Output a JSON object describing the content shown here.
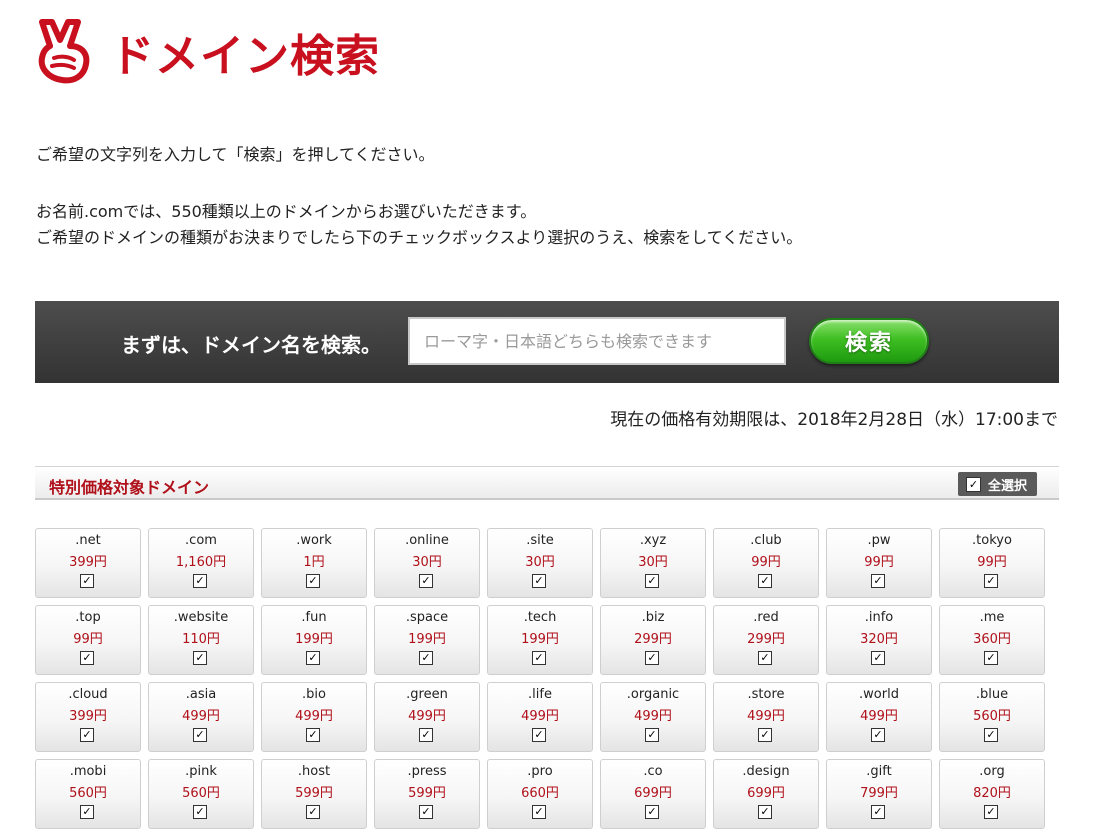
{
  "header": {
    "title": "ドメイン検索",
    "logo_icon": "hand-v-sign-logo",
    "brand_color": "#c8101e"
  },
  "intro": {
    "line1": "ご希望の文字列を入力して「検索」を押してください。",
    "line2": "お名前.comでは、550種類以上のドメインからお選びいただきます。",
    "line3": "ご希望のドメインの種類がお決まりでしたら下のチェックボックスより選択のうえ、検索をしてください。"
  },
  "search": {
    "label": "まずは、ドメイン名を検索。",
    "placeholder": "ローマ字・日本語どちらも検索できます",
    "value": "",
    "button_label": "検索",
    "button_color": "#3fbf22"
  },
  "price_note": "現在の価格有効期限は、2018年2月28日（水）17:00まで",
  "section": {
    "title": "特別価格対象ドメイン",
    "select_all_label": "全選択",
    "select_all_checked": true
  },
  "domains": [
    {
      "tld": ".net",
      "price": "399円",
      "checked": true
    },
    {
      "tld": ".com",
      "price": "1,160円",
      "checked": true
    },
    {
      "tld": ".work",
      "price": "1円",
      "checked": true
    },
    {
      "tld": ".online",
      "price": "30円",
      "checked": true
    },
    {
      "tld": ".site",
      "price": "30円",
      "checked": true
    },
    {
      "tld": ".xyz",
      "price": "30円",
      "checked": true
    },
    {
      "tld": ".club",
      "price": "99円",
      "checked": true
    },
    {
      "tld": ".pw",
      "price": "99円",
      "checked": true
    },
    {
      "tld": ".tokyo",
      "price": "99円",
      "checked": true
    },
    {
      "tld": ".top",
      "price": "99円",
      "checked": true
    },
    {
      "tld": ".website",
      "price": "110円",
      "checked": true
    },
    {
      "tld": ".fun",
      "price": "199円",
      "checked": true
    },
    {
      "tld": ".space",
      "price": "199円",
      "checked": true
    },
    {
      "tld": ".tech",
      "price": "199円",
      "checked": true
    },
    {
      "tld": ".biz",
      "price": "299円",
      "checked": true
    },
    {
      "tld": ".red",
      "price": "299円",
      "checked": true
    },
    {
      "tld": ".info",
      "price": "320円",
      "checked": true
    },
    {
      "tld": ".me",
      "price": "360円",
      "checked": true
    },
    {
      "tld": ".cloud",
      "price": "399円",
      "checked": true
    },
    {
      "tld": ".asia",
      "price": "499円",
      "checked": true
    },
    {
      "tld": ".bio",
      "price": "499円",
      "checked": true
    },
    {
      "tld": ".green",
      "price": "499円",
      "checked": true
    },
    {
      "tld": ".life",
      "price": "499円",
      "checked": true
    },
    {
      "tld": ".organic",
      "price": "499円",
      "checked": true
    },
    {
      "tld": ".store",
      "price": "499円",
      "checked": true
    },
    {
      "tld": ".world",
      "price": "499円",
      "checked": true
    },
    {
      "tld": ".blue",
      "price": "560円",
      "checked": true
    },
    {
      "tld": ".mobi",
      "price": "560円",
      "checked": true
    },
    {
      "tld": ".pink",
      "price": "560円",
      "checked": true
    },
    {
      "tld": ".host",
      "price": "599円",
      "checked": true
    },
    {
      "tld": ".press",
      "price": "599円",
      "checked": true
    },
    {
      "tld": ".pro",
      "price": "660円",
      "checked": true
    },
    {
      "tld": ".co",
      "price": "699円",
      "checked": true
    },
    {
      "tld": ".design",
      "price": "699円",
      "checked": true
    },
    {
      "tld": ".gift",
      "price": "799円",
      "checked": true
    },
    {
      "tld": ".org",
      "price": "820円",
      "checked": true
    }
  ]
}
